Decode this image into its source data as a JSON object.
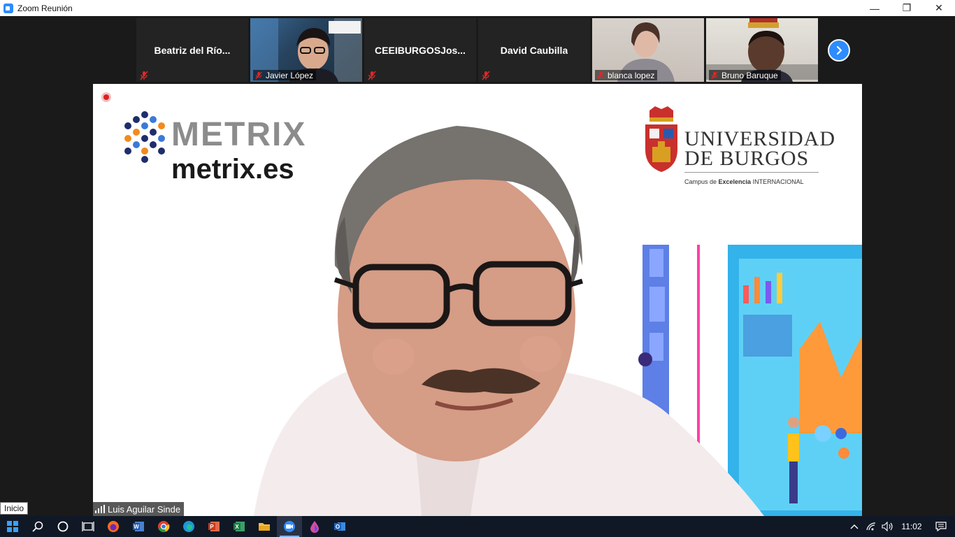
{
  "window": {
    "title": "Zoom Reunión",
    "controls": {
      "minimize": "—",
      "restore": "❐",
      "close": "✕"
    }
  },
  "gallery": {
    "tiles": [
      {
        "name": "Beatriz  del  Río...",
        "video": false,
        "muted": true
      },
      {
        "name": "Javier López",
        "video": true,
        "muted": true
      },
      {
        "name": "CEEIBURGOSJos...",
        "video": false,
        "muted": true
      },
      {
        "name": "David Caubilla",
        "video": false,
        "muted": true
      },
      {
        "name": "blanca lopez",
        "video": true,
        "muted": true
      },
      {
        "name": "Bruno Baruque",
        "video": true,
        "muted": true
      }
    ]
  },
  "main_video": {
    "speaker_name": "Luis Aguilar Sinde",
    "metrix_word": "METRIX",
    "metrix_url": "metrix.es",
    "university_line1": "UNIVERSIDAD",
    "university_line2": "DE BURGOS",
    "campus_prefix": "Campus de ",
    "campus_bold": "Excelencia",
    "campus_suffix": " INTERNACIONAL"
  },
  "tooltip": {
    "text": "Inicio"
  },
  "taskbar": {
    "apps": [
      "windows-start",
      "search",
      "cortana",
      "task-view",
      "firefox",
      "word",
      "chrome",
      "edge",
      "powerpoint",
      "excel",
      "file-explorer",
      "zoom",
      "drop-app",
      "outlook"
    ],
    "active_app": "zoom",
    "clock": "11:02"
  },
  "colors": {
    "zoom_blue": "#2d8cff",
    "mute_red": "#e02828",
    "taskbar": "#101826",
    "tile_bg": "#232323"
  }
}
